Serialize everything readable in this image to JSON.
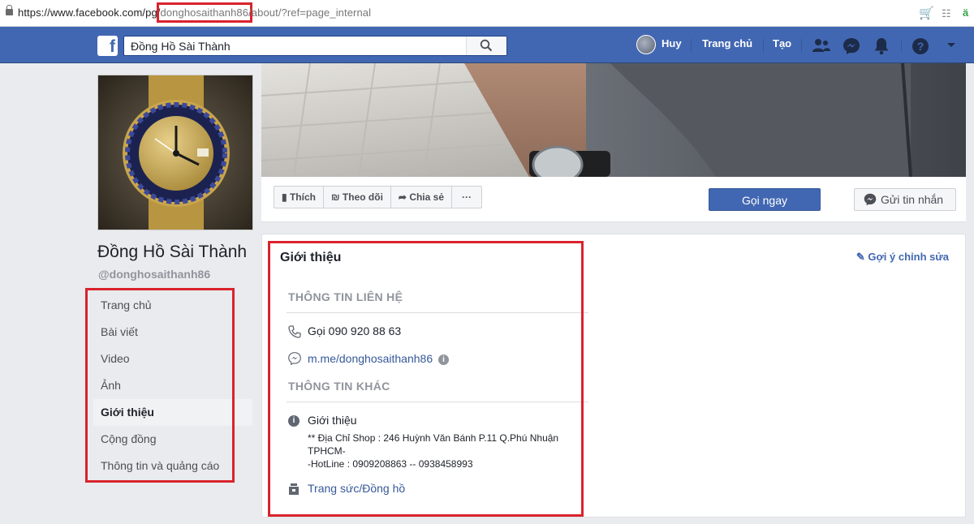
{
  "browser": {
    "url_prefix": "https://www.facebook.com/pg/",
    "url_highlight": "donghosaithanh86",
    "url_suffix": "/about/?ref=page_internal"
  },
  "topbar": {
    "search_value": "Đồng Hồ Sài Thành",
    "user_name": "Huy",
    "home_label": "Trang chủ",
    "create_label": "Tạo"
  },
  "page": {
    "name": "Đồng Hồ Sài Thành",
    "handle": "@donghosaithanh86"
  },
  "left_nav": [
    {
      "label": "Trang chủ",
      "active": false
    },
    {
      "label": "Bài viết",
      "active": false
    },
    {
      "label": "Video",
      "active": false
    },
    {
      "label": "Ảnh",
      "active": false
    },
    {
      "label": "Giới thiệu",
      "active": true
    },
    {
      "label": "Cộng đồng",
      "active": false
    },
    {
      "label": "Thông tin và quảng cáo",
      "active": false
    }
  ],
  "actions": {
    "like_label": "Thích",
    "follow_label": "Theo dõi",
    "share_label": "Chia sẻ",
    "more_label": "···",
    "call_label": "Gọi ngay",
    "message_label": "Gửi tin nhắn"
  },
  "about": {
    "title": "Giới thiệu",
    "suggest_edit": "Gợi ý chỉnh sửa",
    "contact_header": "THÔNG TIN LIÊN HỆ",
    "phone": "Gọi 090 920 88 63",
    "messenger_link": "m.me/donghosaithanh86",
    "other_header": "THÔNG TIN KHÁC",
    "intro_label": "Giới thiệu",
    "intro_line1": "** Địa Chỉ Shop : 246 Huỳnh Văn Bánh P.11 Q.Phú Nhuận",
    "intro_line2": "TPHCM-",
    "intro_line3": "-HotLine : 0909208863 -- 0938458993",
    "category": "Trang sức/Đồng hồ"
  },
  "colors": {
    "fb_blue": "#4267b2",
    "highlight_red": "#d9232d",
    "link_blue": "#365899"
  }
}
